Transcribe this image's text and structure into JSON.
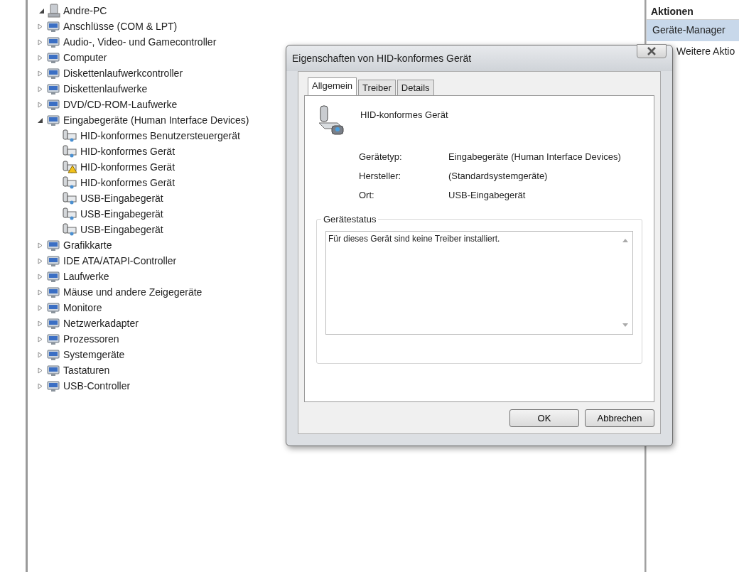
{
  "tree": {
    "label": "Andre-PC",
    "expanded": true,
    "children": [
      {
        "label": "Anschlüsse (COM & LPT)",
        "expanded": false
      },
      {
        "label": "Audio-, Video- und Gamecontroller",
        "expanded": false
      },
      {
        "label": "Computer",
        "expanded": false
      },
      {
        "label": "Diskettenlaufwerkcontroller",
        "expanded": false
      },
      {
        "label": "Diskettenlaufwerke",
        "expanded": false
      },
      {
        "label": "DVD/CD-ROM-Laufwerke",
        "expanded": false
      },
      {
        "label": "Eingabegeräte (Human Interface Devices)",
        "expanded": true,
        "children": [
          {
            "label": "HID-konformes Benutzersteuergerät",
            "warning": false
          },
          {
            "label": "HID-konformes Gerät",
            "warning": false
          },
          {
            "label": "HID-konformes Gerät",
            "warning": true
          },
          {
            "label": "HID-konformes Gerät",
            "warning": false
          },
          {
            "label": "USB-Eingabegerät",
            "warning": false
          },
          {
            "label": "USB-Eingabegerät",
            "warning": false
          },
          {
            "label": "USB-Eingabegerät",
            "warning": false
          }
        ]
      },
      {
        "label": "Grafikkarte",
        "expanded": false
      },
      {
        "label": "IDE ATA/ATAPI-Controller",
        "expanded": false
      },
      {
        "label": "Laufwerke",
        "expanded": false
      },
      {
        "label": "Mäuse und andere Zeigegeräte",
        "expanded": false
      },
      {
        "label": "Monitore",
        "expanded": false
      },
      {
        "label": "Netzwerkadapter",
        "expanded": false
      },
      {
        "label": "Prozessoren",
        "expanded": false
      },
      {
        "label": "Systemgeräte",
        "expanded": false
      },
      {
        "label": "Tastaturen",
        "expanded": false
      },
      {
        "label": "USB-Controller",
        "expanded": false
      }
    ]
  },
  "actions": {
    "title": "Aktionen",
    "items": [
      {
        "label": "Geräte-Manager",
        "selected": true
      },
      {
        "label": "Weitere Aktio",
        "selected": false
      }
    ]
  },
  "dialog": {
    "title": "Eigenschaften von HID-konformes Gerät",
    "tabs": [
      {
        "label": "Allgemein",
        "selected": true
      },
      {
        "label": "Treiber",
        "selected": false
      },
      {
        "label": "Details",
        "selected": false
      }
    ],
    "device_name": "HID-konformes Gerät",
    "properties": [
      {
        "label": "Gerätetyp:",
        "value": "Eingabegeräte (Human Interface Devices)"
      },
      {
        "label": "Hersteller:",
        "value": "(Standardsystemgeräte)"
      },
      {
        "label": "Ort:",
        "value": "USB-Eingabegerät"
      }
    ],
    "status": {
      "title": "Gerätestatus",
      "text": "Für dieses Gerät sind keine Treiber installiert."
    },
    "buttons": [
      "OK",
      "Abbrechen"
    ]
  }
}
